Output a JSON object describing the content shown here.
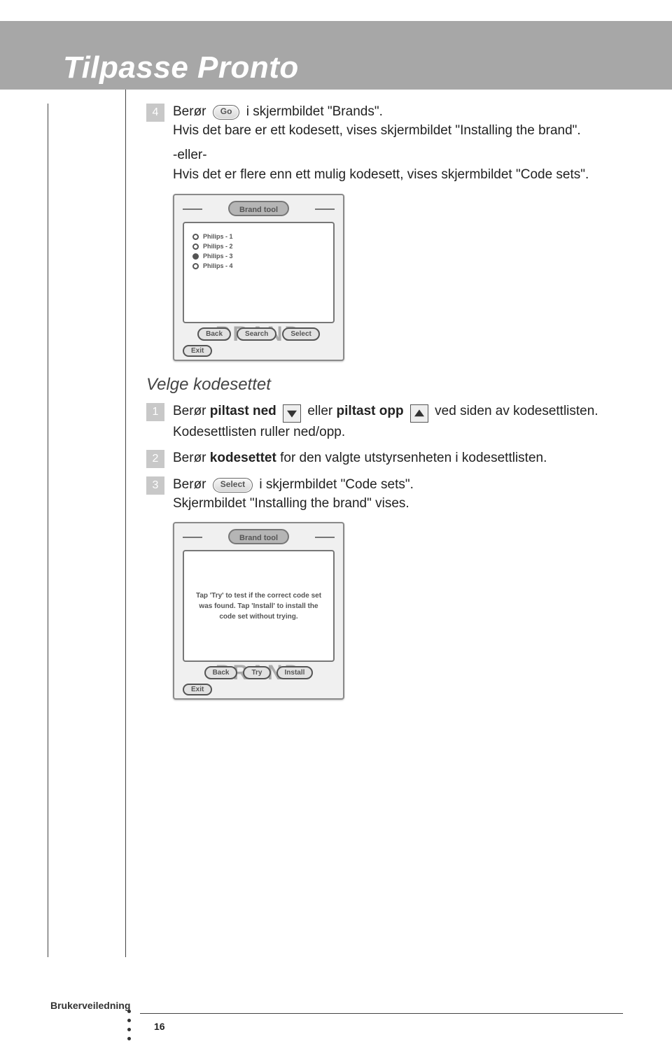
{
  "header": {
    "title": "Tilpasse Pronto"
  },
  "steps_a": {
    "s4": {
      "num": "4",
      "before": "Berør",
      "button": "Go",
      "after": "i skjermbildet \"Brands\".",
      "line2": "Hvis det bare er ett kodesett, vises skjermbildet \"Installing the brand\"."
    },
    "or": "-eller-",
    "or_text": "Hvis det er flere enn ett mulig kodesett, vises skjermbildet \"Code sets\"."
  },
  "device1": {
    "title": "Brand tool",
    "items": [
      "Philips - 1",
      "Philips - 2",
      "Philips - 3",
      "Philips - 4"
    ],
    "buttons": [
      "Back",
      "Search",
      "Select"
    ],
    "exit": "Exit",
    "bg": "BRAND"
  },
  "subhead": "Velge kodesettet",
  "steps_b": {
    "s1": {
      "num": "1",
      "t1": "Berør",
      "b1": "piltast ned",
      "mid": "eller",
      "b2": "piltast opp",
      "t2": "ved siden av kodesettlisten.",
      "line2": "Kodesettlisten ruller ned/opp."
    },
    "s2": {
      "num": "2",
      "t1": "Berør",
      "b1": "kodesettet",
      "t2": "for den valgte utstyrsenheten i kodesettlisten."
    },
    "s3": {
      "num": "3",
      "t1": "Berør",
      "button": "Select",
      "t2": "i skjermbildet \"Code sets\".",
      "line2": "Skjermbildet \"Installing the brand\" vises."
    }
  },
  "device2": {
    "title": "Brand tool",
    "msg": "Tap 'Try' to test if the correct code set was found.\nTap 'Install' to install the code set without trying.",
    "buttons": [
      "Back",
      "Try",
      "Install"
    ],
    "exit": "Exit",
    "bg": "BRAND"
  },
  "footer": {
    "label": "Brukerveiledning",
    "page": "16"
  }
}
